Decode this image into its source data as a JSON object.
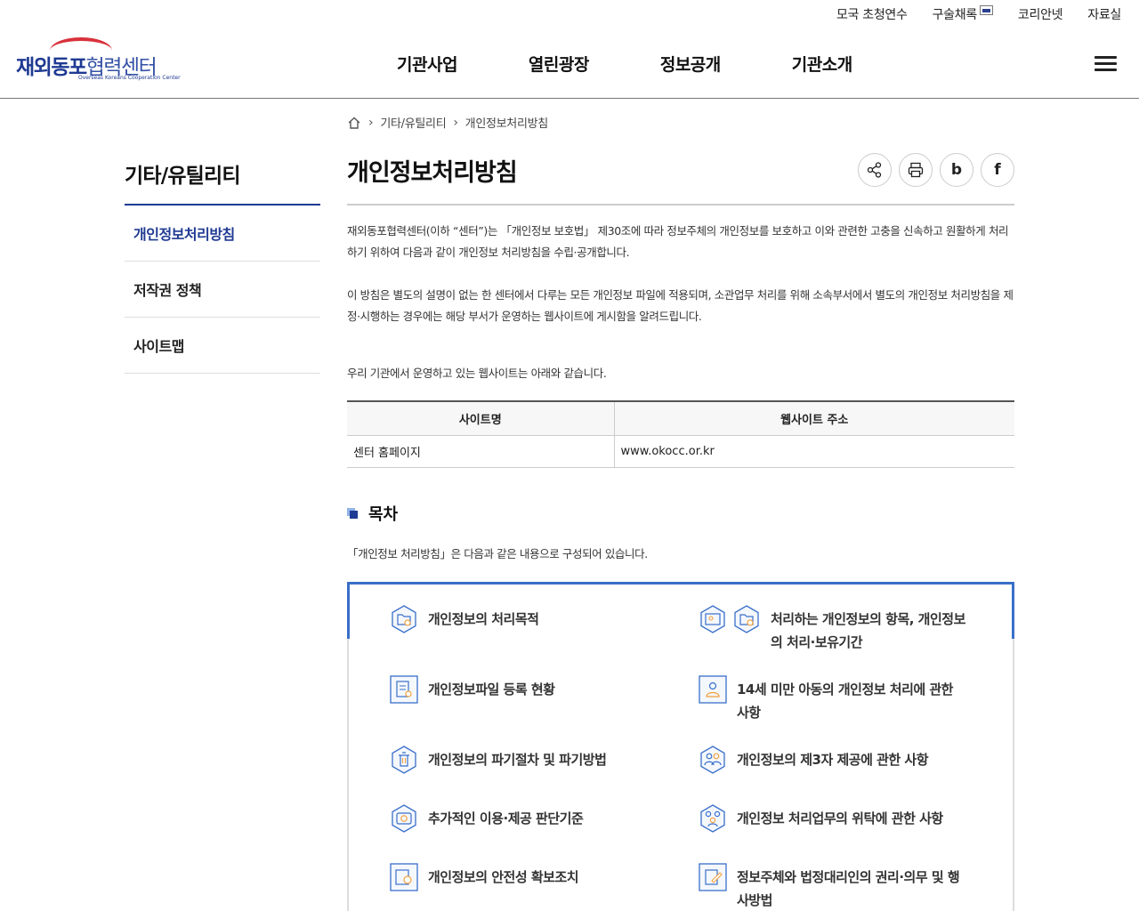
{
  "util_links": [
    "모국 초청연수",
    "구술채록",
    "코리안넷",
    "자료실"
  ],
  "logo": {
    "main_strong": "재외동포",
    "main_light": "협력센터",
    "sub": "Overseas Koreans Cooperation Center"
  },
  "gnb": [
    "기관사업",
    "열린광장",
    "정보공개",
    "기관소개"
  ],
  "sidebar": {
    "title": "기타/유틸리티",
    "items": [
      {
        "label": "개인정보처리방침",
        "active": true
      },
      {
        "label": "저작권 정책",
        "active": false
      },
      {
        "label": "사이트맵",
        "active": false
      }
    ]
  },
  "breadcrumb": [
    "기타/유틸리티",
    "개인정보처리방침"
  ],
  "page_title": "개인정보처리방침",
  "tools": {
    "blog": "b",
    "facebook": "f"
  },
  "intro": [
    "재외동포협력센터(이하 “센터”)는 「개인정보 보호법」 제30조에 따라 정보주체의 개인정보를 보호하고 이와 관련한 고충을 신속하고 원활하게 처리하기 위하여 다음과 같이 개인정보 처리방침을 수립·공개합니다.",
    "이 방침은 별도의 설명이 없는 한 센터에서 다루는 모든 개인정보 파일에 적용되며, 소관업무 처리를 위해 소속부서에서 별도의 개인정보 처리방침을 제정·시행하는 경우에는 해당 부서가 운영하는 웹사이트에 게시함을 알려드립니다.",
    "우리 기관에서 운영하고 있는 웹사이트는 아래와 같습니다."
  ],
  "site_table": {
    "headers": [
      "사이트명",
      "웹사이트 주소"
    ],
    "rows": [
      [
        "센터 홈페이지",
        "www.okocc.or.kr"
      ]
    ]
  },
  "toc": {
    "title": "목차",
    "desc": "「개인정보 처리방침」은 다음과 같은 내용으로 구성되어 있습니다.",
    "items": [
      "개인정보의 처리목적",
      "처리하는 개인정보의 항목, 개인정보의 처리·보유기간",
      "개인정보파일 등록 현황",
      "14세 미만 아동의 개인정보 처리에 관한 사항",
      "개인정보의 파기절차 및 파기방법",
      "개인정보의 제3자 제공에 관한 사항",
      "추가적인 이용·제공 판단기준",
      "개인정보 처리업무의 위탁에 관한 사항",
      "개인정보의 안전성 확보조치",
      "정보주체와 법정대리인의 권리·의무 및 행사방법"
    ]
  },
  "colors": {
    "brand": "#1f3a93",
    "accent_red": "#d9313b",
    "toc_border": "#3a6fc9"
  }
}
